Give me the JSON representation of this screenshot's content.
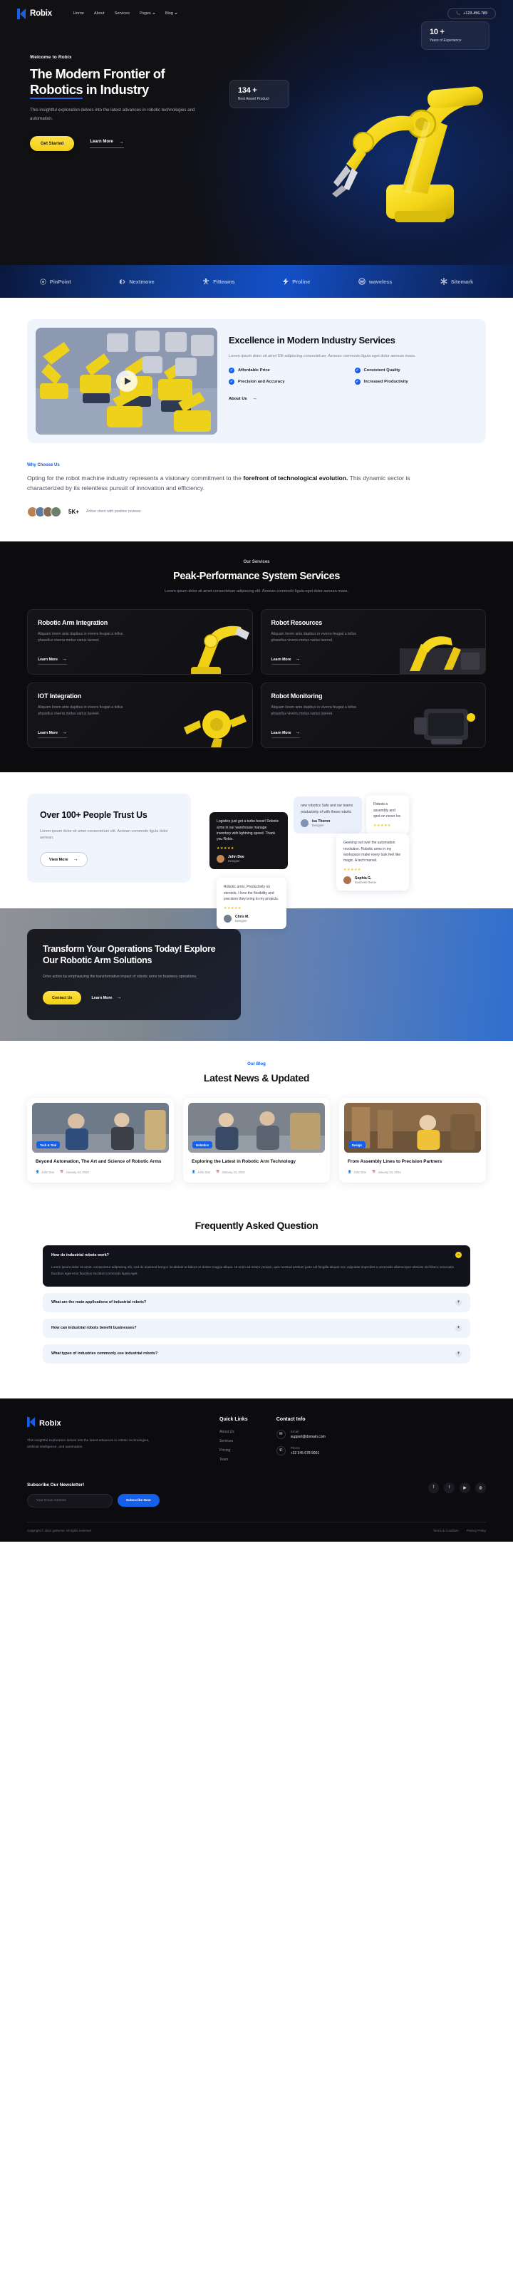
{
  "nav": {
    "brand": "Robix",
    "links": [
      {
        "label": "Home",
        "caret": false
      },
      {
        "label": "About",
        "caret": false
      },
      {
        "label": "Services",
        "caret": false
      },
      {
        "label": "Pages",
        "caret": true
      },
      {
        "label": "Blog",
        "caret": true
      }
    ],
    "phone": "+123-456-789"
  },
  "hero": {
    "eyebrow": "Welcome to Robix",
    "title_line1_a": "The Modern Frontier of",
    "title_underlined": "Robotics",
    "title_line2_b": " in Industry",
    "subtitle": "This insightful exploration delves into the latest advances in robotic technologies and automation.",
    "primary_cta": "Get Started",
    "secondary_cta": "Learn More",
    "stat_experience_value": "10 +",
    "stat_experience_label": "Years of Experience",
    "stat_award_value": "134 +",
    "stat_award_label": "Best Award Product"
  },
  "partners": [
    {
      "name": "PinPoint",
      "icon": "target-icon"
    },
    {
      "name": "Nextmove",
      "icon": "nextmove-icon"
    },
    {
      "name": "Fitteams",
      "icon": "fitteams-icon"
    },
    {
      "name": "Proline",
      "icon": "bolt-icon"
    },
    {
      "name": "waveless",
      "icon": "wave-icon"
    },
    {
      "name": "Sitemark",
      "icon": "asterisk-icon"
    }
  ],
  "excellence": {
    "title": "Excellence in Modern Industry Services",
    "desc": "Lorem ipsum dolor sit amet Elit adipiscing consectetuer. Aenean commodo ligula eget dolor aenean mass.",
    "features": [
      "Affordable Price",
      "Consistent Quality",
      "Precision and Accuracy",
      "Increased Productivity"
    ],
    "about_link": "About Us"
  },
  "why": {
    "kicker": "Why Choose Us",
    "text_a": "Opting for the robot machine industry represents a visionary commitment to the ",
    "text_bold": "forefront of technological evolution.",
    "text_b": " This dynamic sector is characterized by its relentless pursuit of innovation and efficiency.",
    "rating": "5K+",
    "rating_caption": "Active client with positive reviews."
  },
  "services": {
    "kicker": "Our Services",
    "title": "Peak-Performance System Services",
    "subtitle": "Lorem ipsum dolor sit amet consectetuer adipiscing elit. Aenean commodo ligula eget dolor aenean mass.",
    "cards": [
      {
        "title": "Robotic Arm Integration",
        "desc": "Aliquam lorem ante dapibus in viverra feugiat a tellus phasellus viverra metus varius laoreet.",
        "link": "Learn More"
      },
      {
        "title": "Robot Resources",
        "desc": "Aliquam lorem ante dapibus in viverra feugiat a tellus phasellus viverra metus varius laoreet.",
        "link": "Learn More"
      },
      {
        "title": "IOT Integration",
        "desc": "Aliquam lorem ante dapibus in viverra feugiat a tellus phasellus viverra metus varius laoreet.",
        "link": "Learn More"
      },
      {
        "title": "Robot Monitoring",
        "desc": "Aliquam lorem ante dapibus in viverra feugiat a tellus phasellus viverra metus varius laoreet.",
        "link": "Learn More"
      }
    ]
  },
  "testimonials": {
    "heading": "Over 100+ People Trust Us",
    "desc": "Lorem ipsum dolor sit amet consectetuer elit. Aenean commodo ligula dolor aenean.",
    "button": "View More",
    "cards": [
      {
        "text": "Logistics just got a turbo boost! Robotic arms in our warehouse manage inventory with lightning speed. Thank you Robix.",
        "stars": "★★★★★",
        "name": "John Doe",
        "role": "Designer",
        "style": "dark"
      },
      {
        "text": "new robotics Safe and our teams productivity of with these robotic",
        "stars": "★★★★★",
        "name": "isa Theron",
        "role": "Designer",
        "style": "blue"
      },
      {
        "text": "Robots a assembly and spot-on never loc",
        "stars": "★★★★★",
        "name": "",
        "role": "",
        "style": "light"
      },
      {
        "text": "Geeking out over the automation revolution. Robotic arms in my workspace make every task feel like magic. A tech marvel.",
        "stars": "★★★★★",
        "name": "Sophia G.",
        "role": "Business Owner",
        "style": "light"
      },
      {
        "text": "Robotic arms, Productivity on steroids. I love the flexibility and precision they bring to my projects.",
        "stars": "★★★★★",
        "name": "Chris M.",
        "role": "Designer",
        "style": "light"
      }
    ]
  },
  "cta": {
    "title": "Transform Your Operations Today! Explore Our Robotic Arm Solutions",
    "desc": "Drive action by emphasizing the transformative impact of robotic arms on business operations.",
    "primary": "Contact Us",
    "secondary": "Learn More"
  },
  "blog": {
    "kicker": "Our Blog",
    "title": "Latest News & Updated",
    "posts": [
      {
        "tag": "Tech & Tool",
        "title": "Beyond Automation, The Art and Science of Robotic Arms",
        "author": "John Doe",
        "date": "January 24, 2024"
      },
      {
        "tag": "Robotics",
        "title": "Exploring the Latest in Robotic Arm Technology",
        "author": "John Doe",
        "date": "January 24, 2024"
      },
      {
        "tag": "Design",
        "title": "From Assembly Lines to Precision Partners",
        "author": "John Doe",
        "date": "January 24, 2024"
      }
    ]
  },
  "faq": {
    "title": "Frequently Asked Question",
    "items": [
      {
        "q": "How do industrial robots work?",
        "a": "Lorem ipsum dolor sit amet, consectetur adipiscing elit, sed do eiusmod tempor incididunt ut labore et dolore magna aliqua. Ut enim ad minim veniam, quis nostrud pretium justo vel fringilla aliquet nec vulputate imperdiet a venenatis ullamcorper ultricies nisl libero venenatis faucibus eget eros faucibus tincidunt commodo ligula eget.",
        "open": true
      },
      {
        "q": "What are the main applications of industrial robots?",
        "a": "",
        "open": false
      },
      {
        "q": "How can industrial robots benefit businesses?",
        "a": "",
        "open": false
      },
      {
        "q": "What types of industries commonly use industrial robots?",
        "a": "",
        "open": false
      }
    ]
  },
  "footer": {
    "brand": "Robix",
    "desc": "This insightful exploration delves into the latest advances in robotic technologies, artificial intelligence, and automation.",
    "quick_links_title": "Quick Links",
    "quick_links": [
      "About Us",
      "Services",
      "Pricing",
      "Team"
    ],
    "contact_title": "Contact Info",
    "contact": [
      {
        "icon": "mail-icon",
        "label": "Email",
        "value": "support@domain.com"
      },
      {
        "icon": "phone-icon",
        "label": "Phone",
        "value": "+22 345 678 9001"
      }
    ],
    "newsletter_title": "Subscribe Our Newsletter!",
    "newsletter_placeholder": "Your Email Address",
    "newsletter_button": "Subscribe Now",
    "socials": [
      "facebook-icon",
      "twitter-icon",
      "youtube-icon",
      "dribbble-icon"
    ],
    "copyright": "Copyright © 2024 gotheme. All rights reserved.",
    "legal": [
      "Terms & Condition",
      "Privacy Policy"
    ]
  }
}
